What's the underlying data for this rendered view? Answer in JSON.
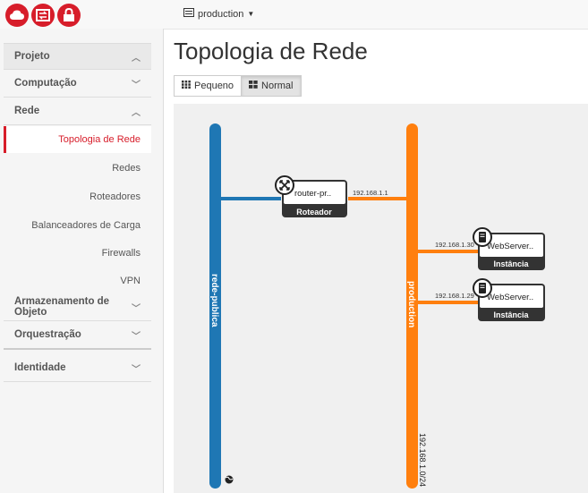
{
  "header": {
    "project_switcher": "production"
  },
  "sidebar": {
    "projeto": "Projeto",
    "computacao": "Computação",
    "rede": "Rede",
    "rede_items": [
      "Topologia de Rede",
      "Redes",
      "Roteadores",
      "Balanceadores de Carga",
      "Firewalls",
      "VPN"
    ],
    "armazenamento": "Armazenamento de Objeto",
    "orquestracao": "Orquestração",
    "identidade": "Identidade"
  },
  "page": {
    "title": "Topologia de Rede",
    "view_small": "Pequeno",
    "view_normal": "Normal"
  },
  "topology": {
    "networks": [
      {
        "label": "rede-publica",
        "color": "#1f77b4"
      },
      {
        "label": "production",
        "color": "#ff7f0e",
        "cidr": "192.168.1.0/24"
      }
    ],
    "router": {
      "name": "router-pr..",
      "type": "Roteador",
      "ip": "192.168.1.1"
    },
    "instances": [
      {
        "name": "WebServer..",
        "type": "Instância",
        "ip": "192.168.1.30"
      },
      {
        "name": "WebServer..",
        "type": "Instância",
        "ip": "192.168.1.29"
      }
    ]
  },
  "colors": {
    "accent": "#d71d2a"
  }
}
